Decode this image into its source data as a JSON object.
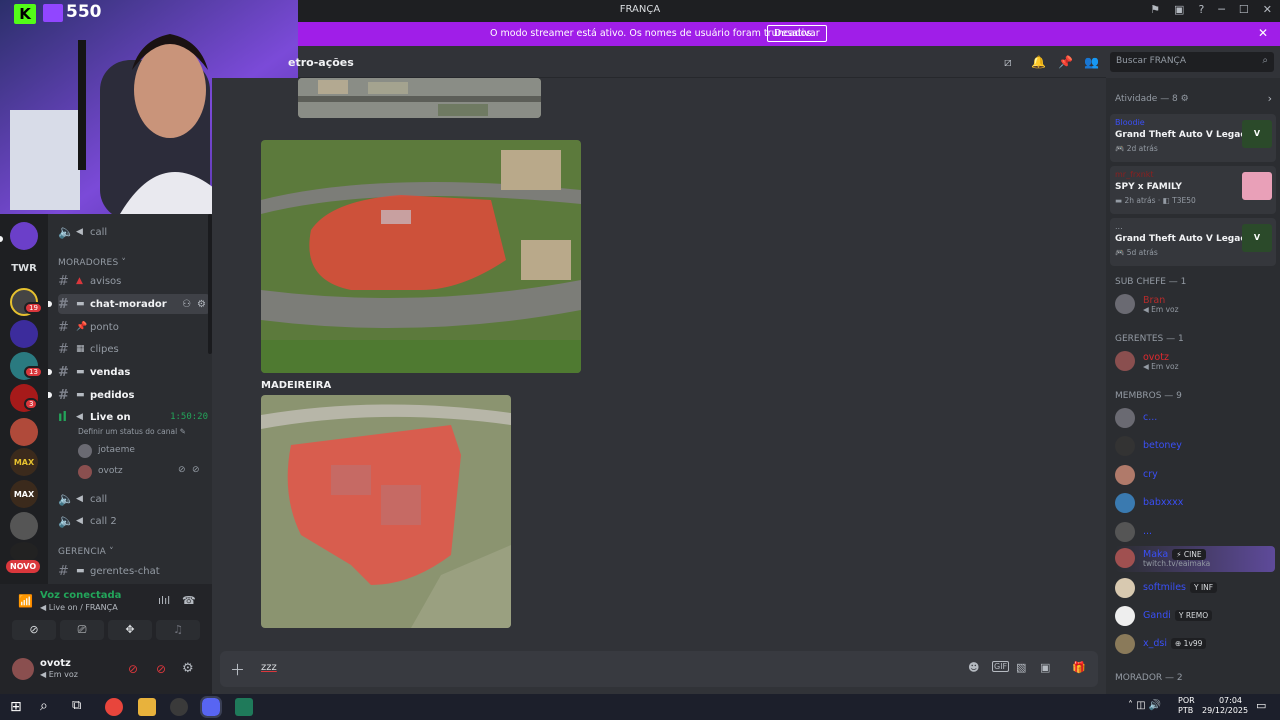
{
  "window": {
    "title": "FRANÇA"
  },
  "banner": {
    "message": "O modo streamer está ativo. Os nomes de usuário foram truncados.",
    "button": "Desativar"
  },
  "overlay": {
    "k_logo": "K",
    "viewers": "550"
  },
  "servers": [
    {
      "label": "",
      "badge": ""
    },
    {
      "label": "TWR",
      "badge": ""
    },
    {
      "label": "",
      "badge": "19"
    },
    {
      "label": "",
      "badge": ""
    },
    {
      "label": "",
      "badge": "13"
    },
    {
      "label": "",
      "badge": "3"
    },
    {
      "label": "",
      "badge": ""
    },
    {
      "label": "MAX",
      "badge": ""
    },
    {
      "label": "MAX",
      "badge": ""
    },
    {
      "label": "",
      "badge": ""
    },
    {
      "label": "NOVO",
      "badge": ""
    }
  ],
  "channels": {
    "call_top": "call",
    "cat_moradores": "MORADORES",
    "avisos": "avisos",
    "chat_morador": "chat-morador",
    "ponto": "ponto",
    "clipes": "clipes",
    "vendas": "vendas",
    "pedidos": "pedidos",
    "live_on": "Live on",
    "live_time": "1:50:20",
    "live_status": "Definir um status do canal",
    "voice_users": [
      "jotaeme",
      "ovotz"
    ],
    "call": "call",
    "call2": "call 2",
    "cat_gerencia": "GERENCIA",
    "gerentes_chat": "gerentes-chat"
  },
  "voice": {
    "status": "Voz conectada",
    "where": "Live on / FRANÇA"
  },
  "user": {
    "name": "ovotz",
    "status": "Em voz"
  },
  "header": {
    "channel": "etro-ações",
    "search_placeholder": "Buscar FRANÇA"
  },
  "messages": {
    "label_madeireira": "MADEIREIRA"
  },
  "composer": {
    "text": "zzz"
  },
  "members": {
    "activity_title": "Atividade — 8",
    "activities": [
      {
        "name": "Bloodie",
        "game": "Grand Theft Auto V Legacy",
        "meta": "2d atrás",
        "extra": ""
      },
      {
        "name": "mr_frxnkt",
        "game": "SPY x FAMILY",
        "meta": "2h atrás",
        "extra": "T3E50"
      },
      {
        "name": "...",
        "game": "Grand Theft Auto V Legacy",
        "meta": "5d atrás",
        "extra": ""
      }
    ],
    "groups": [
      {
        "title": "SUB CHEFE — 1",
        "rows": [
          {
            "name": "Bran",
            "sub": "Em voz",
            "color": "#b52b2b",
            "tag": ""
          }
        ]
      },
      {
        "title": "GERENTES — 1",
        "rows": [
          {
            "name": "ovotz",
            "sub": "Em voz",
            "color": "#e0292e",
            "tag": ""
          }
        ]
      },
      {
        "title": "MEMBROS — 9",
        "rows": [
          {
            "name": "c...",
            "sub": "",
            "color": "#3a4ff5",
            "tag": ""
          },
          {
            "name": "betoney",
            "sub": "",
            "color": "#3a4ff5",
            "tag": ""
          },
          {
            "name": "cry",
            "sub": "",
            "color": "#3a4ff5",
            "tag": ""
          },
          {
            "name": "babxxxx",
            "sub": "",
            "color": "#3a4ff5",
            "tag": ""
          },
          {
            "name": "...",
            "sub": "",
            "color": "#3a4ff5",
            "tag": ""
          },
          {
            "name": "Maka",
            "sub": "twitch.tv/eaimaka",
            "color": "#3a4ff5",
            "tag": "⚡ CINE"
          },
          {
            "name": "softmiles",
            "sub": "",
            "color": "#3a4ff5",
            "tag": "Y INF"
          },
          {
            "name": "Gandi",
            "sub": "",
            "color": "#3a4ff5",
            "tag": "Y REMO"
          },
          {
            "name": "x_dsi",
            "sub": "",
            "color": "#3a4ff5",
            "tag": "⊕ 1v99"
          }
        ]
      },
      {
        "title": "MORADOR — 2",
        "rows": []
      }
    ]
  },
  "taskbar": {
    "lang": "POR",
    "layout": "PTB",
    "time": "07:04",
    "date": "29/12/2025"
  },
  "colors": {
    "accent": "#a01ee8",
    "voice_green": "#23a55a",
    "danger": "#da373c",
    "bg": "#313338"
  }
}
